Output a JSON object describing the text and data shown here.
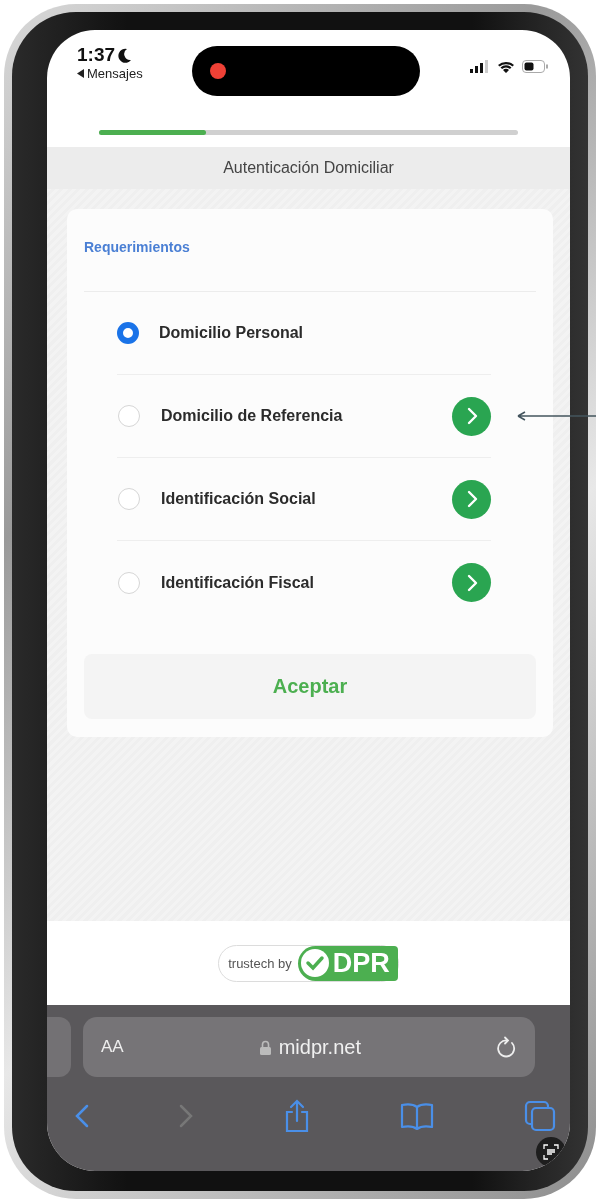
{
  "status_bar": {
    "time": "1:37",
    "back_label": "Mensajes",
    "recording": true
  },
  "progress": {
    "level": 0.255
  },
  "header": {
    "title": "Autenticación Domiciliar"
  },
  "card": {
    "title": "Requerimientos",
    "items": [
      {
        "label": "Domicilio Personal",
        "selected": true,
        "action": false
      },
      {
        "label": "Domicilio de Referencia",
        "selected": false,
        "action": true
      },
      {
        "label": "Identificación Social",
        "selected": false,
        "action": true
      },
      {
        "label": "Identificación Fiscal",
        "selected": false,
        "action": true
      }
    ],
    "button": "Aceptar"
  },
  "footer": {
    "prefix": "trustech by",
    "brand": "DPR"
  },
  "browser": {
    "text_size": "AA",
    "url": "midpr.net",
    "back_enabled": true,
    "forward_enabled": false
  }
}
